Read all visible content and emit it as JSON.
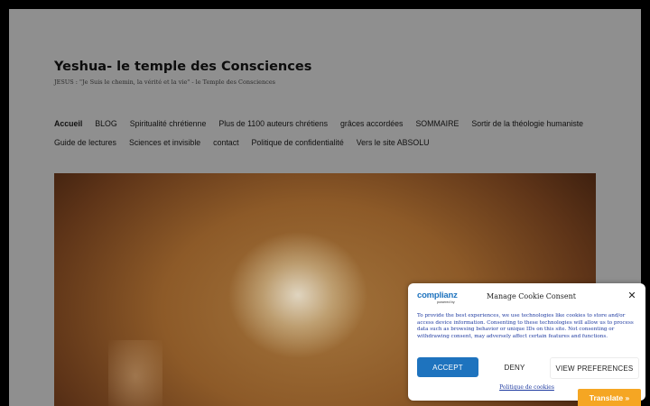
{
  "site": {
    "title": "Yeshua- le temple des Consciences",
    "description": "JESUS : \"Je Suis le chemin, la vérité et la vie\" - le Temple des Consciences"
  },
  "nav": {
    "row1": [
      {
        "label": "Accueil",
        "active": true
      },
      {
        "label": "BLOG"
      },
      {
        "label": "Spiritualité chrétienne"
      },
      {
        "label": "Plus de 1100 auteurs chrétiens"
      },
      {
        "label": "grâces accordées"
      },
      {
        "label": "SOMMAIRE"
      },
      {
        "label": "Sortir de la théologie humaniste"
      }
    ],
    "row2": [
      {
        "label": "Guide de lectures"
      },
      {
        "label": "Sciences et invisible"
      },
      {
        "label": "contact"
      },
      {
        "label": "Politique de confidentialité"
      },
      {
        "label": "Vers le site ABSOLU"
      }
    ]
  },
  "cookie": {
    "logo_text": "complianz",
    "logo_sub": "powered by",
    "title": "Manage Cookie Consent",
    "close_icon": "close-icon",
    "text": "To provide the best experiences, we use technologies like cookies to store and/or access device information. Consenting to these technologies will allow us to process data such as browsing behavior or unique IDs on this site. Not consenting or withdrawing consent, may adversely affect certain features and functions.",
    "accept_label": "ACCEPT",
    "deny_label": "DENY",
    "prefs_label": "VIEW PREFERENCES",
    "policy_label": "Politique de cookies",
    "accent_color": "#1e73be"
  },
  "translate": {
    "label": "Translate »",
    "color": "#f5a623"
  }
}
